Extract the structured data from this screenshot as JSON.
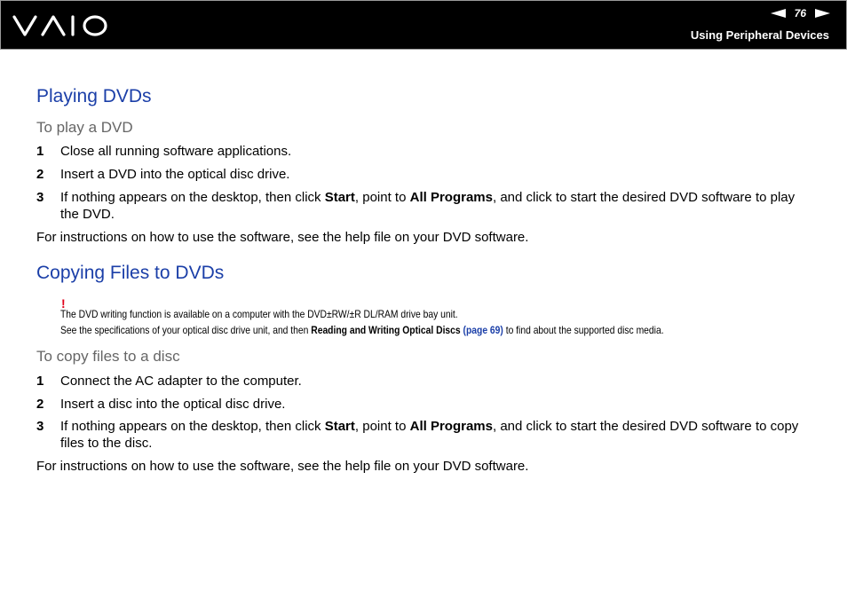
{
  "header": {
    "page_number": "76",
    "section_title": "Using Peripheral Devices"
  },
  "playing": {
    "title": "Playing DVDs",
    "subtitle": "To play a DVD",
    "steps": [
      {
        "num": "1",
        "text": "Close all running software applications."
      },
      {
        "num": "2",
        "text": "Insert a DVD into the optical disc drive."
      },
      {
        "num": "3",
        "pre": "If nothing appears on the desktop, then click ",
        "b1": "Start",
        "mid": ", point to ",
        "b2": "All Programs",
        "post": ", and click to start the desired DVD software to play the DVD."
      }
    ],
    "footer": "For instructions on how to use the software, see the help file on your DVD software."
  },
  "copying": {
    "title": "Copying Files to DVDs",
    "warning_mark": "!",
    "note_line1": "The DVD writing function is available on a computer with the DVD±RW/±R DL/RAM drive bay unit.",
    "note_line2_pre": "See the specifications of your optical disc drive unit, and then ",
    "note_line2_bold": "Reading and Writing Optical Discs",
    "note_line2_link": "(page 69)",
    "note_line2_post": " to find about the supported disc media.",
    "subtitle": "To copy files to a disc",
    "steps": [
      {
        "num": "1",
        "text": "Connect the AC adapter to the computer."
      },
      {
        "num": "2",
        "text": "Insert a disc into the optical disc drive."
      },
      {
        "num": "3",
        "pre": "If nothing appears on the desktop, then click ",
        "b1": "Start",
        "mid": ", point to ",
        "b2": "All Programs",
        "post": ", and click to start the desired DVD software to copy files to the disc."
      }
    ],
    "footer": "For instructions on how to use the software, see the help file on your DVD software."
  }
}
